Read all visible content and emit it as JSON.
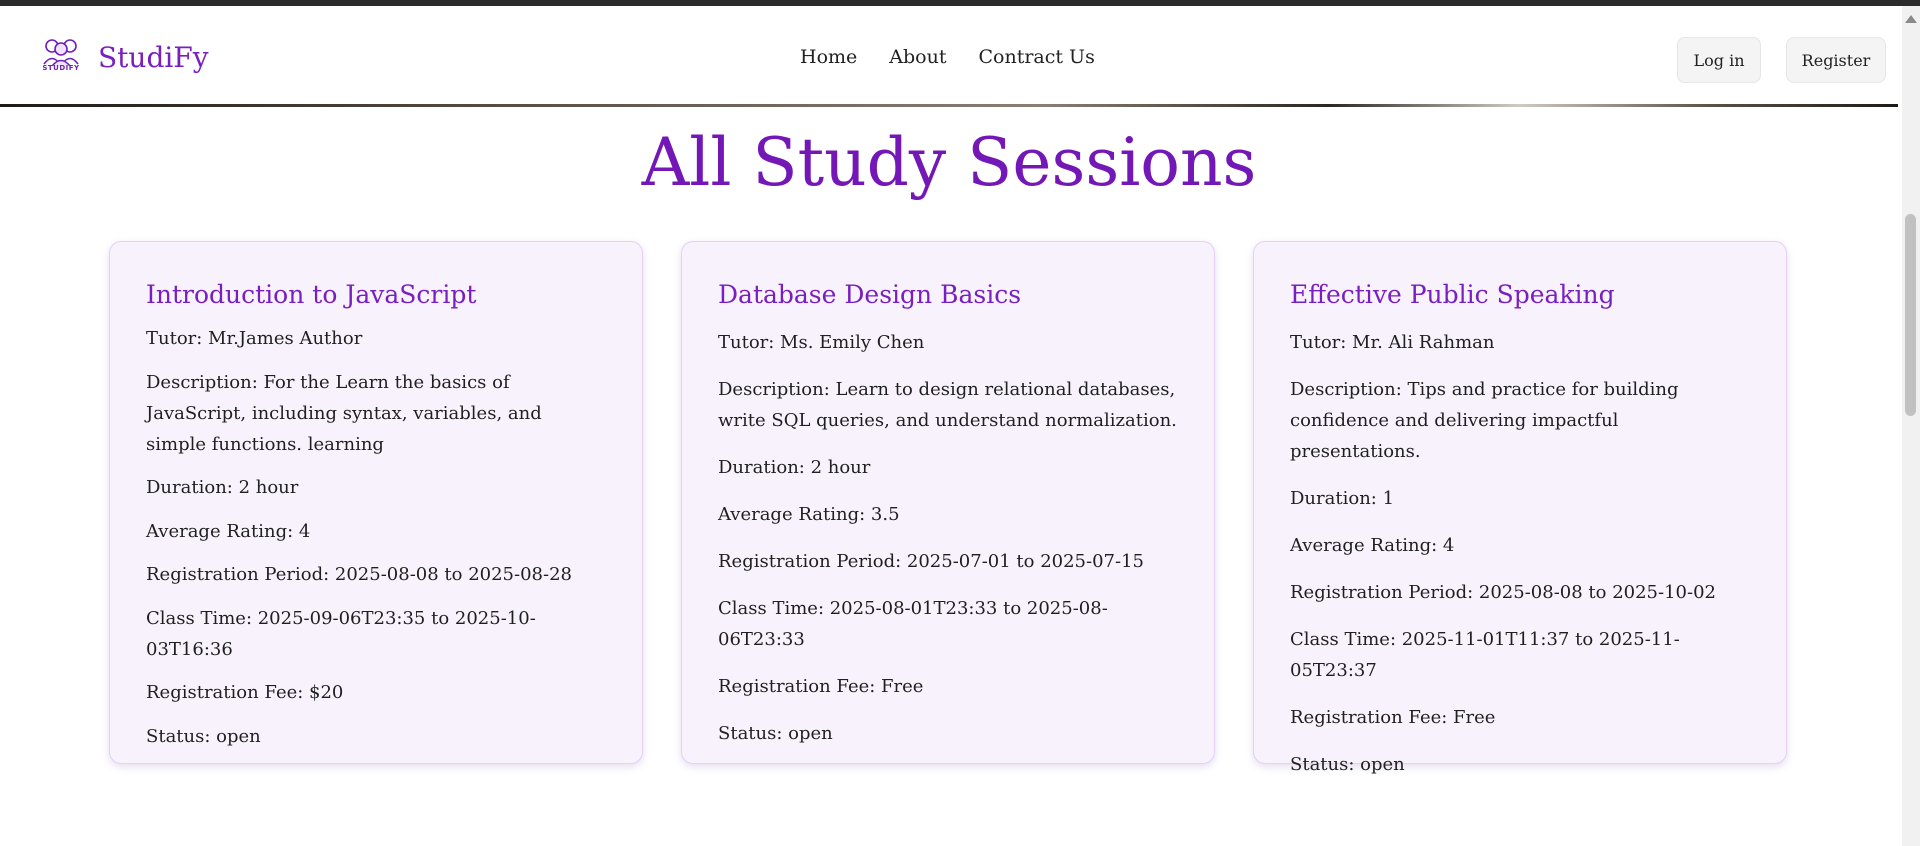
{
  "brand": {
    "name": "StudiFy",
    "logo_text": "STUDIFY",
    "logo_icon": "students-icon"
  },
  "nav": {
    "links": [
      "Home",
      "About",
      "Contract Us"
    ]
  },
  "auth": {
    "login_label": "Log in",
    "register_label": "Register"
  },
  "page": {
    "title": "All Study Sessions"
  },
  "sessions": [
    {
      "title": "Introduction to JavaScript",
      "tutor": "Tutor: Mr.James Author",
      "description": "Description: For the Learn the basics of JavaScript, including syntax, variables, and simple functions. learning",
      "duration": "Duration: 2 hour",
      "rating": "Average Rating: 4",
      "registration_period": "Registration Period: 2025-08-08 to 2025-08-28",
      "class_time": "Class Time: 2025-09-06T23:35 to 2025-10-03T16:36",
      "fee": "Registration Fee: $20",
      "status": "Status: open"
    },
    {
      "title": "Database Design Basics",
      "tutor": "Tutor: Ms. Emily Chen",
      "description": "Description: Learn to design relational databases, write SQL queries, and understand normalization.",
      "duration": "Duration: 2 hour",
      "rating": "Average Rating: 3.5",
      "registration_period": "Registration Period: 2025-07-01 to 2025-07-15",
      "class_time": "Class Time: 2025-08-01T23:33 to 2025-08-06T23:33",
      "fee": "Registration Fee: Free",
      "status": "Status: open"
    },
    {
      "title": "Effective Public Speaking",
      "tutor": "Tutor: Mr. Ali Rahman",
      "description": "Description: Tips and practice for building confidence and delivering impactful presentations.",
      "duration": "Duration: 1",
      "rating": "Average Rating: 4",
      "registration_period": "Registration Period: 2025-08-08 to 2025-10-02",
      "class_time": "Class Time: 2025-11-01T11:37 to 2025-11-05T23:37",
      "fee": "Registration Fee: Free",
      "status": "Status: open"
    }
  ],
  "colors": {
    "accent": "#7417b7",
    "card_bg": "#f8f2fd",
    "card_border": "#e3cffa"
  }
}
